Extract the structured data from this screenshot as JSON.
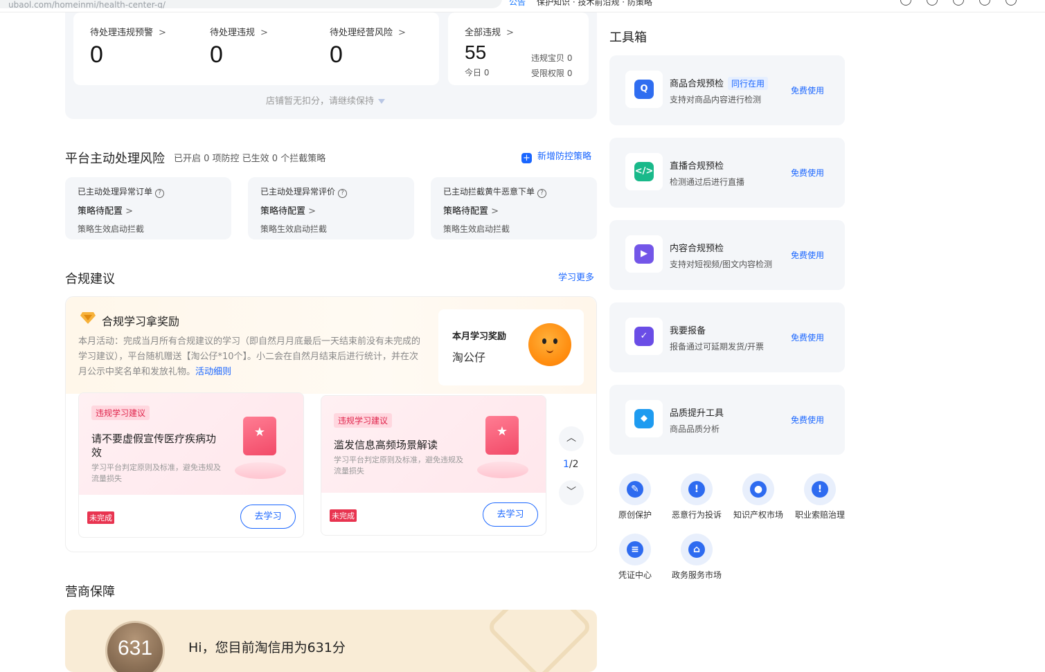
{
  "browser": {
    "url": "ubaol.com/homeinmi/health-center-q/",
    "nav_active": "公告",
    "nav_rest": "保护知识 · 技术前沿规 · 防策略"
  },
  "stats": {
    "pending_warning_label": "待处理违规预警",
    "pending_warning_value": "0",
    "pending_violation_label": "待处理违规",
    "pending_violation_value": "0",
    "pending_risk_label": "待处理经营风险",
    "pending_risk_value": "0",
    "all_violation_label": "全部违规",
    "all_violation_value": "55",
    "today_label": "今日 0",
    "violation_item_label": "违规宝贝 0",
    "restricted_label": "受限权限 0",
    "hint": "店铺暂无扣分，请继续保持"
  },
  "platform_risk": {
    "title": "平台主动处理风险",
    "subtitle": "已开启 0 项防控 已生效 0 个拦截策略",
    "add_link": "新增防控策略",
    "cards": [
      {
        "label": "已主动处理异常订单",
        "status": "策略待配置",
        "desc": "策略生效启动拦截"
      },
      {
        "label": "已主动处理异常评价",
        "status": "策略待配置",
        "desc": "策略生效启动拦截"
      },
      {
        "label": "已主动拦截黄牛恶意下单",
        "status": "策略待配置",
        "desc": "策略生效启动拦截"
      }
    ]
  },
  "compliance": {
    "title": "合规建议",
    "more_link": "学习更多",
    "reward_title": "合规学习拿奖励",
    "reward_desc": "本月活动：完成当月所有合规建议的学习（即自然月月底最后一天结束前没有未完成的学习建议），平台随机赠送【淘公仔*10个】。小二会在自然月结束后进行统计，并在次月公示中奖名单和发放礼物。",
    "reward_link": "活动细则",
    "monthly_reward_label": "本月学习奖励",
    "monthly_reward_item": "淘公仔",
    "cards": [
      {
        "tag": "违规学习建议",
        "title": "请不要虚假宣传医疗疾病功效",
        "desc": "学习平台判定原则及标准，避免违规及流量损失",
        "status": "未完成",
        "button": "去学习"
      },
      {
        "tag": "违规学习建议",
        "title": "滥发信息高频场景解读",
        "desc": "学习平台判定原则及标准，避免违规及流量损失",
        "status": "未完成",
        "button": "去学习"
      }
    ],
    "pager_current": "1",
    "pager_total": "/2"
  },
  "merchant": {
    "title": "营商保障",
    "score": "631",
    "greeting": "Hi，您目前淘信用为631分"
  },
  "toolbox": {
    "title": "工具箱",
    "tools": [
      {
        "name": "商品合规预检",
        "tag": "同行在用",
        "desc": "支持对商品内容进行检测",
        "link": "免费使用",
        "icon": "shield-icon",
        "color": "#2f6df0",
        "glyph": "Q"
      },
      {
        "name": "直播合规预检",
        "tag": "",
        "desc": "检测通过后进行直播",
        "link": "免费使用",
        "icon": "code-icon",
        "color": "#19b98a",
        "glyph": "</>"
      },
      {
        "name": "内容合规预检",
        "tag": "",
        "desc": "支持对短视频/图文内容检测",
        "link": "免费使用",
        "icon": "video-icon",
        "color": "#7356e8",
        "glyph": "▶"
      },
      {
        "name": "我要报备",
        "tag": "",
        "desc": "报备通过可延期发货/开票",
        "link": "免费使用",
        "icon": "report-icon",
        "color": "#6a4de6",
        "glyph": "✓"
      },
      {
        "name": "品质提升工具",
        "tag": "",
        "desc": "商品品质分析",
        "link": "免费使用",
        "icon": "diamond-icon",
        "color": "#1e9bf0",
        "glyph": "◆"
      }
    ],
    "shortcuts": [
      {
        "label": "原创保护",
        "icon": "pen-icon",
        "glyph": "✎"
      },
      {
        "label": "恶意行为投诉",
        "icon": "alert-icon",
        "glyph": "!"
      },
      {
        "label": "知识产权市场",
        "icon": "bulb-icon",
        "glyph": "●"
      },
      {
        "label": "职业索赔治理",
        "icon": "alert-icon",
        "glyph": "!"
      },
      {
        "label": "凭证中心",
        "icon": "ticket-icon",
        "glyph": "≡"
      },
      {
        "label": "政务服务市场",
        "icon": "bank-icon",
        "glyph": "⌂"
      }
    ]
  }
}
